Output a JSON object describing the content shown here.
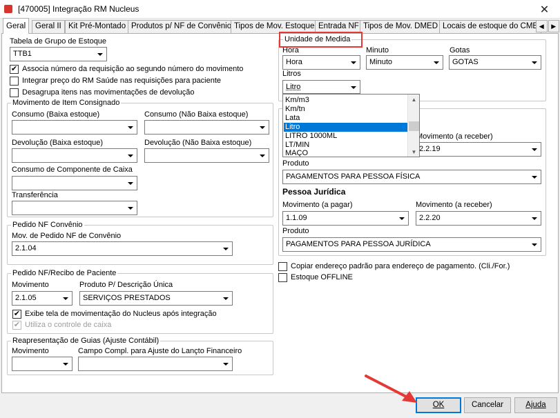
{
  "window": {
    "title": "[470005]  Integração RM Nucleus",
    "close_glyph": "✕"
  },
  "tabs": [
    {
      "label": "Geral"
    },
    {
      "label": "Geral II"
    },
    {
      "label": "Kit Pré-Montado"
    },
    {
      "label": "Produtos p/ NF de Convênio"
    },
    {
      "label": "Tipos de Mov. Estoque"
    },
    {
      "label": "Entrada NF"
    },
    {
      "label": "Tipos de Mov. DMED"
    },
    {
      "label": "Locais de estoque do CME"
    }
  ],
  "tab_arrows": {
    "left": "◀",
    "right": "▶"
  },
  "estoque": {
    "table_label": "Tabela de Grupo de Estoque",
    "table_value": "TTB1",
    "chk_associa": "Associa número da requisição ao segundo número do movimento",
    "chk_associa_checked": "✔",
    "chk_integrar": "Integrar preço do RM Saúde nas requisições para paciente",
    "chk_desagrupa": "Desagrupa itens nas movimentações de  devolução"
  },
  "consignado": {
    "legend": "Movimento de Item Consignado",
    "consumo_baixa": "Consumo (Baixa estoque)",
    "consumo_nao_baixa": "Consumo (Não Baixa estoque)",
    "devolucao_baixa": "Devolução (Baixa estoque)",
    "devolucao_nao_baixa": "Devolução (Não Baixa estoque)",
    "consumo_componente": "Consumo de Componente de Caixa",
    "transferencia": "Transferência"
  },
  "pedido_convenio": {
    "legend": "Pedido NF Convênio",
    "mov_label": "Mov. de Pedido NF de Convênio",
    "mov_value": "2.1.04"
  },
  "pedido_paciente": {
    "legend": "Pedido NF/Recibo de Paciente",
    "movimento_label": "Movimento",
    "movimento_value": "2.1.05",
    "produto_label": "Produto P/ Descrição Única",
    "produto_value": "SERVIÇOS PRESTADOS",
    "chk_exibe": "Exibe tela de movimentação do Nucleus após integração",
    "chk_exibe_checked": "✔",
    "chk_utiliza": "Utiliza o controle de caixa",
    "chk_utiliza_checked": "✔"
  },
  "reapresentacao": {
    "legend": "Reapresentação de Guias (Ajuste Contábil)",
    "movimento_label": "Movimento",
    "campo_label": "Campo Compl. para Ajuste do Lançto Financeiro"
  },
  "unidade": {
    "legend": "Unidade de Medida",
    "hora_label": "Hora",
    "hora_value": "Hora",
    "minuto_label": "Minuto",
    "minuto_value": "Minuto",
    "gotas_label": "Gotas",
    "gotas_value": "GOTAS",
    "litros_label": "Litros",
    "litros_value": "Litro",
    "dropdown_options": [
      "Km/m3",
      "Km/tn",
      "Lata",
      "Litro",
      "LITRO 1000ML",
      "LT/MIN",
      "MAÇO"
    ],
    "dropdown_selected": "Litro"
  },
  "pessoa_fisica": {
    "mov_receber_label": "Movimento (a receber)",
    "mov_receber_value": "2.2.19",
    "produto_label": "Produto",
    "produto_value": "PAGAMENTOS PARA PESSOA FÍSICA"
  },
  "pessoa_juridica": {
    "heading": "Pessoa Jurídica",
    "mov_pagar_label": "Movimento (a pagar)",
    "mov_pagar_value": "1.1.09",
    "mov_receber_label": "Movimento (a receber)",
    "mov_receber_value": "2.2.20",
    "produto_label": "Produto",
    "produto_value": "PAGAMENTOS PARA PESSOA JURÍDICA"
  },
  "options": {
    "chk_copiar": "Copiar endereço padrão para endereço de pagamento. (Cli./For.)",
    "chk_estoque_offline": "Estoque OFFLINE"
  },
  "buttons": {
    "ok": "OK",
    "cancelar": "Cancelar",
    "ajuda": "Ajuda"
  },
  "colors": {
    "highlight": "#e53935",
    "selection": "#0078d7"
  }
}
